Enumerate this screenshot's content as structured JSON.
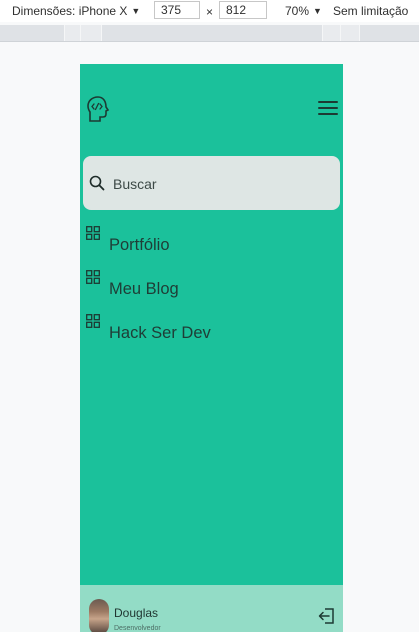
{
  "devtools": {
    "dimensions_label": "Dimensões: iPhone X",
    "width": "375",
    "times": "×",
    "height": "812",
    "zoom": "70%",
    "throttling": "Sem limitação"
  },
  "search": {
    "placeholder": "Buscar"
  },
  "nav": {
    "items": [
      {
        "label": "Portfólio"
      },
      {
        "label": "Meu Blog"
      },
      {
        "label": "Hack Ser Dev"
      }
    ]
  },
  "user": {
    "name": "Douglas",
    "role": "Desenvolvedor"
  },
  "colors": {
    "primary": "#1bc19b",
    "footer": "#93dcc6",
    "search_bg": "#dee6e4",
    "page_bg": "#f8f9fa"
  },
  "icons": {
    "logo": "head-code-icon",
    "menu": "hamburger-icon",
    "search": "search-icon",
    "nav": "grid-icon",
    "logout": "logout-icon"
  }
}
